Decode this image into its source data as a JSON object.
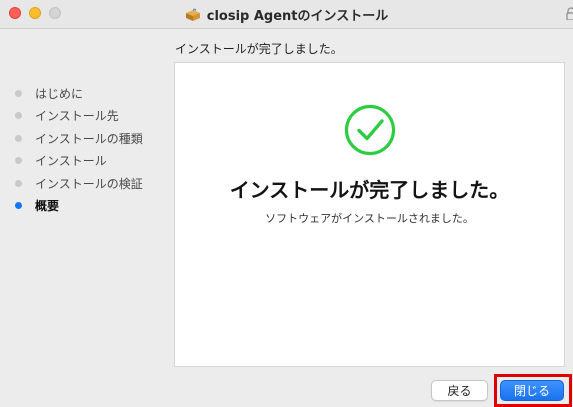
{
  "window": {
    "title": "closip Agentのインストール",
    "title_icon": "package-icon"
  },
  "heading": "インストールが完了しました。",
  "steps": [
    {
      "label": "はじめに",
      "active": false
    },
    {
      "label": "インストール先",
      "active": false
    },
    {
      "label": "インストールの種類",
      "active": false
    },
    {
      "label": "インストール",
      "active": false
    },
    {
      "label": "インストールの検証",
      "active": false
    },
    {
      "label": "概要",
      "active": true
    }
  ],
  "content": {
    "status_icon": "success-check-icon",
    "main_message": "インストールが完了しました。",
    "sub_message": "ソフトウェアがインストールされました。"
  },
  "buttons": {
    "back_label": "戻る",
    "close_label": "閉じる"
  },
  "colors": {
    "accent": "#1677f2",
    "success": "#2ecc40",
    "highlight": "#e10000"
  }
}
